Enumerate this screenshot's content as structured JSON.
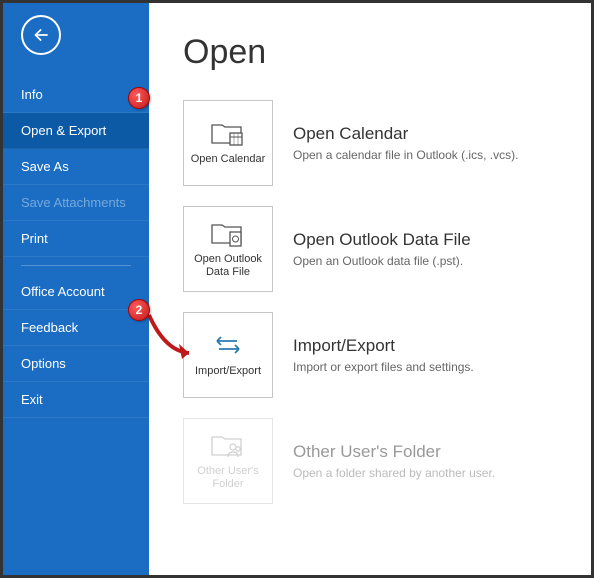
{
  "sidebar": {
    "items": [
      {
        "label": "Info",
        "selected": false,
        "disabled": false
      },
      {
        "label": "Open & Export",
        "selected": true,
        "disabled": false
      },
      {
        "label": "Save As",
        "selected": false,
        "disabled": false
      },
      {
        "label": "Save Attachments",
        "selected": false,
        "disabled": true
      },
      {
        "label": "Print",
        "selected": false,
        "disabled": false
      }
    ],
    "lower_items": [
      {
        "label": "Office Account"
      },
      {
        "label": "Feedback"
      },
      {
        "label": "Options"
      },
      {
        "label": "Exit"
      }
    ]
  },
  "page": {
    "title": "Open"
  },
  "options": [
    {
      "tile_label": "Open Calendar",
      "title": "Open Calendar",
      "desc": "Open a calendar file in Outlook (.ics, .vcs).",
      "icon": "calendar-folder-icon",
      "disabled": false
    },
    {
      "tile_label": "Open Outlook Data File",
      "title": "Open Outlook Data File",
      "desc": "Open an Outlook data file (.pst).",
      "icon": "data-file-folder-icon",
      "disabled": false
    },
    {
      "tile_label": "Import/Export",
      "title": "Import/Export",
      "desc": "Import or export files and settings.",
      "icon": "import-export-icon",
      "disabled": false
    },
    {
      "tile_label": "Other User's Folder",
      "title": "Other User's Folder",
      "desc": "Open a folder shared by another user.",
      "icon": "user-folder-icon",
      "disabled": true
    }
  ],
  "callouts": {
    "c1": "1",
    "c2": "2"
  }
}
